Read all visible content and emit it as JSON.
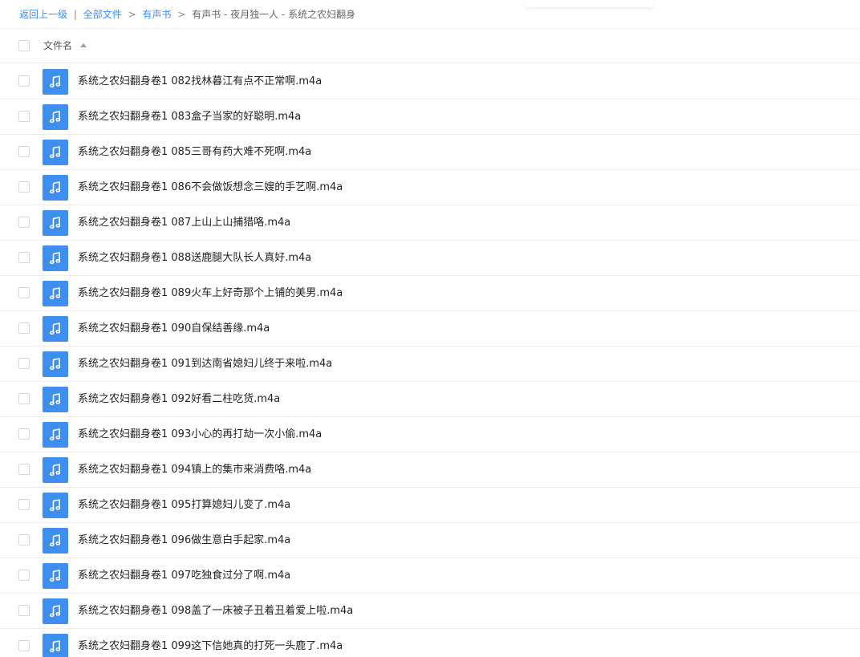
{
  "breadcrumb": {
    "back": "返回上一级",
    "divider": "|",
    "all_files": "全部文件",
    "arrow": ">",
    "folder": "有声书",
    "current": "有声书 - 夜月独一人 - 系统之农妇翻身"
  },
  "header": {
    "col_name": "文件名"
  },
  "files": [
    "系统之农妇翻身卷1 082找林暮江有点不正常啊.m4a",
    "系统之农妇翻身卷1 083盒子当家的好聪明.m4a",
    "系统之农妇翻身卷1 085三哥有药大难不死啊.m4a",
    "系统之农妇翻身卷1 086不会做饭想念三嫂的手艺啊.m4a",
    "系统之农妇翻身卷1 087上山上山捕猎咯.m4a",
    "系统之农妇翻身卷1 088送鹿腿大队长人真好.m4a",
    "系统之农妇翻身卷1 089火车上好奇那个上铺的美男.m4a",
    "系统之农妇翻身卷1 090自保结善缘.m4a",
    "系统之农妇翻身卷1 091到达南省媳妇儿终于来啦.m4a",
    "系统之农妇翻身卷1 092好看二柱吃货.m4a",
    "系统之农妇翻身卷1 093小心的再打劫一次小偷.m4a",
    "系统之农妇翻身卷1 094镇上的集市来消费咯.m4a",
    "系统之农妇翻身卷1 095打算媳妇儿变了.m4a",
    "系统之农妇翻身卷1 096做生意白手起家.m4a",
    "系统之农妇翻身卷1 097吃独食过分了啊.m4a",
    "系统之农妇翻身卷1 098盖了一床被子丑着丑着爱上啦.m4a",
    "系统之农妇翻身卷1 099这下信她真的打死一头鹿了.m4a"
  ],
  "icons": {
    "file": "music-note-icon",
    "sort": "sort-ascending-icon"
  },
  "colors": {
    "link": "#3b8cff",
    "file_icon_bg": "#3d8ef0"
  }
}
